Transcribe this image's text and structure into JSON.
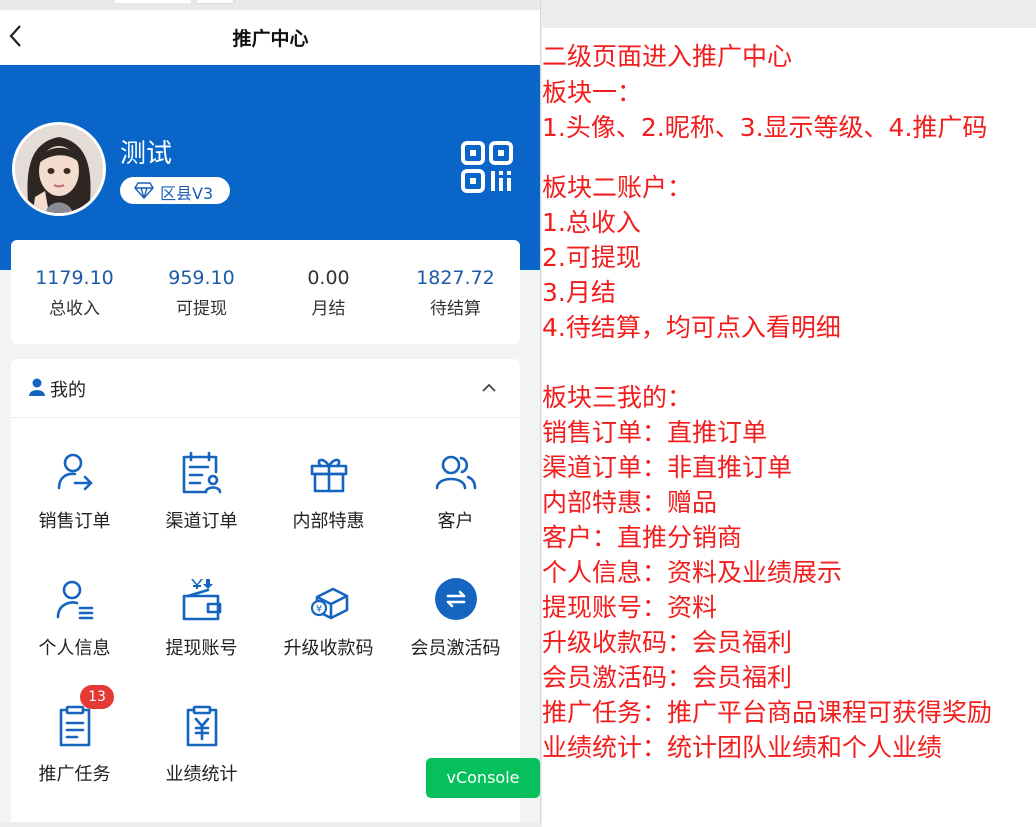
{
  "nav": {
    "title": "推广中心"
  },
  "profile": {
    "nickname": "测试",
    "level": "区县V3"
  },
  "account": [
    {
      "value": "1179.10",
      "label": "总收入"
    },
    {
      "value": "959.10",
      "label": "可提现"
    },
    {
      "value": "0.00",
      "label": "月结"
    },
    {
      "value": "1827.72",
      "label": "待结算"
    }
  ],
  "mine": {
    "title": "我的",
    "items": [
      {
        "label": "销售订单",
        "icon": "user-arrow-icon"
      },
      {
        "label": "渠道订单",
        "icon": "calendar-user-icon"
      },
      {
        "label": "内部特惠",
        "icon": "gift-icon"
      },
      {
        "label": "客户",
        "icon": "users-icon"
      },
      {
        "label": "个人信息",
        "icon": "user-list-icon"
      },
      {
        "label": "提现账号",
        "icon": "wallet-icon"
      },
      {
        "label": "升级收款码",
        "icon": "coin-box-icon"
      },
      {
        "label": "会员激活码",
        "icon": "exchange-icon"
      },
      {
        "label": "推广任务",
        "icon": "clipboard-icon",
        "badge": "13"
      },
      {
        "label": "业绩统计",
        "icon": "yuan-clipboard-icon"
      }
    ]
  },
  "vconsole_label": "vConsole",
  "notes": [
    " 二级页面进入推广中心",
    " 板块一：",
    "  1.头像、2.昵称、3.显示等级、4.推广码",
    "",
    "板块二账户：",
    "1.总收入",
    "2.可提现",
    "3.月结",
    "4.待结算，均可点入看明细",
    "",
    "板块三我的：",
    "销售订单：直推订单",
    "渠道订单：非直推订单",
    "内部特惠：赠品",
    "客户：直推分销商",
    "个人信息：资料及业绩展示",
    "提现账号：资料",
    "升级收款码：会员福利",
    "会员激活码：会员福利",
    "推广任务：推广平台商品课程可获得奖励",
    "业绩统计：统计团队业绩和个人业绩"
  ],
  "colors": {
    "brand_blue": "#0a65c8",
    "note_red": "#f21d1d",
    "badge_red": "#e53935",
    "vconsole_green": "#06c15b"
  }
}
